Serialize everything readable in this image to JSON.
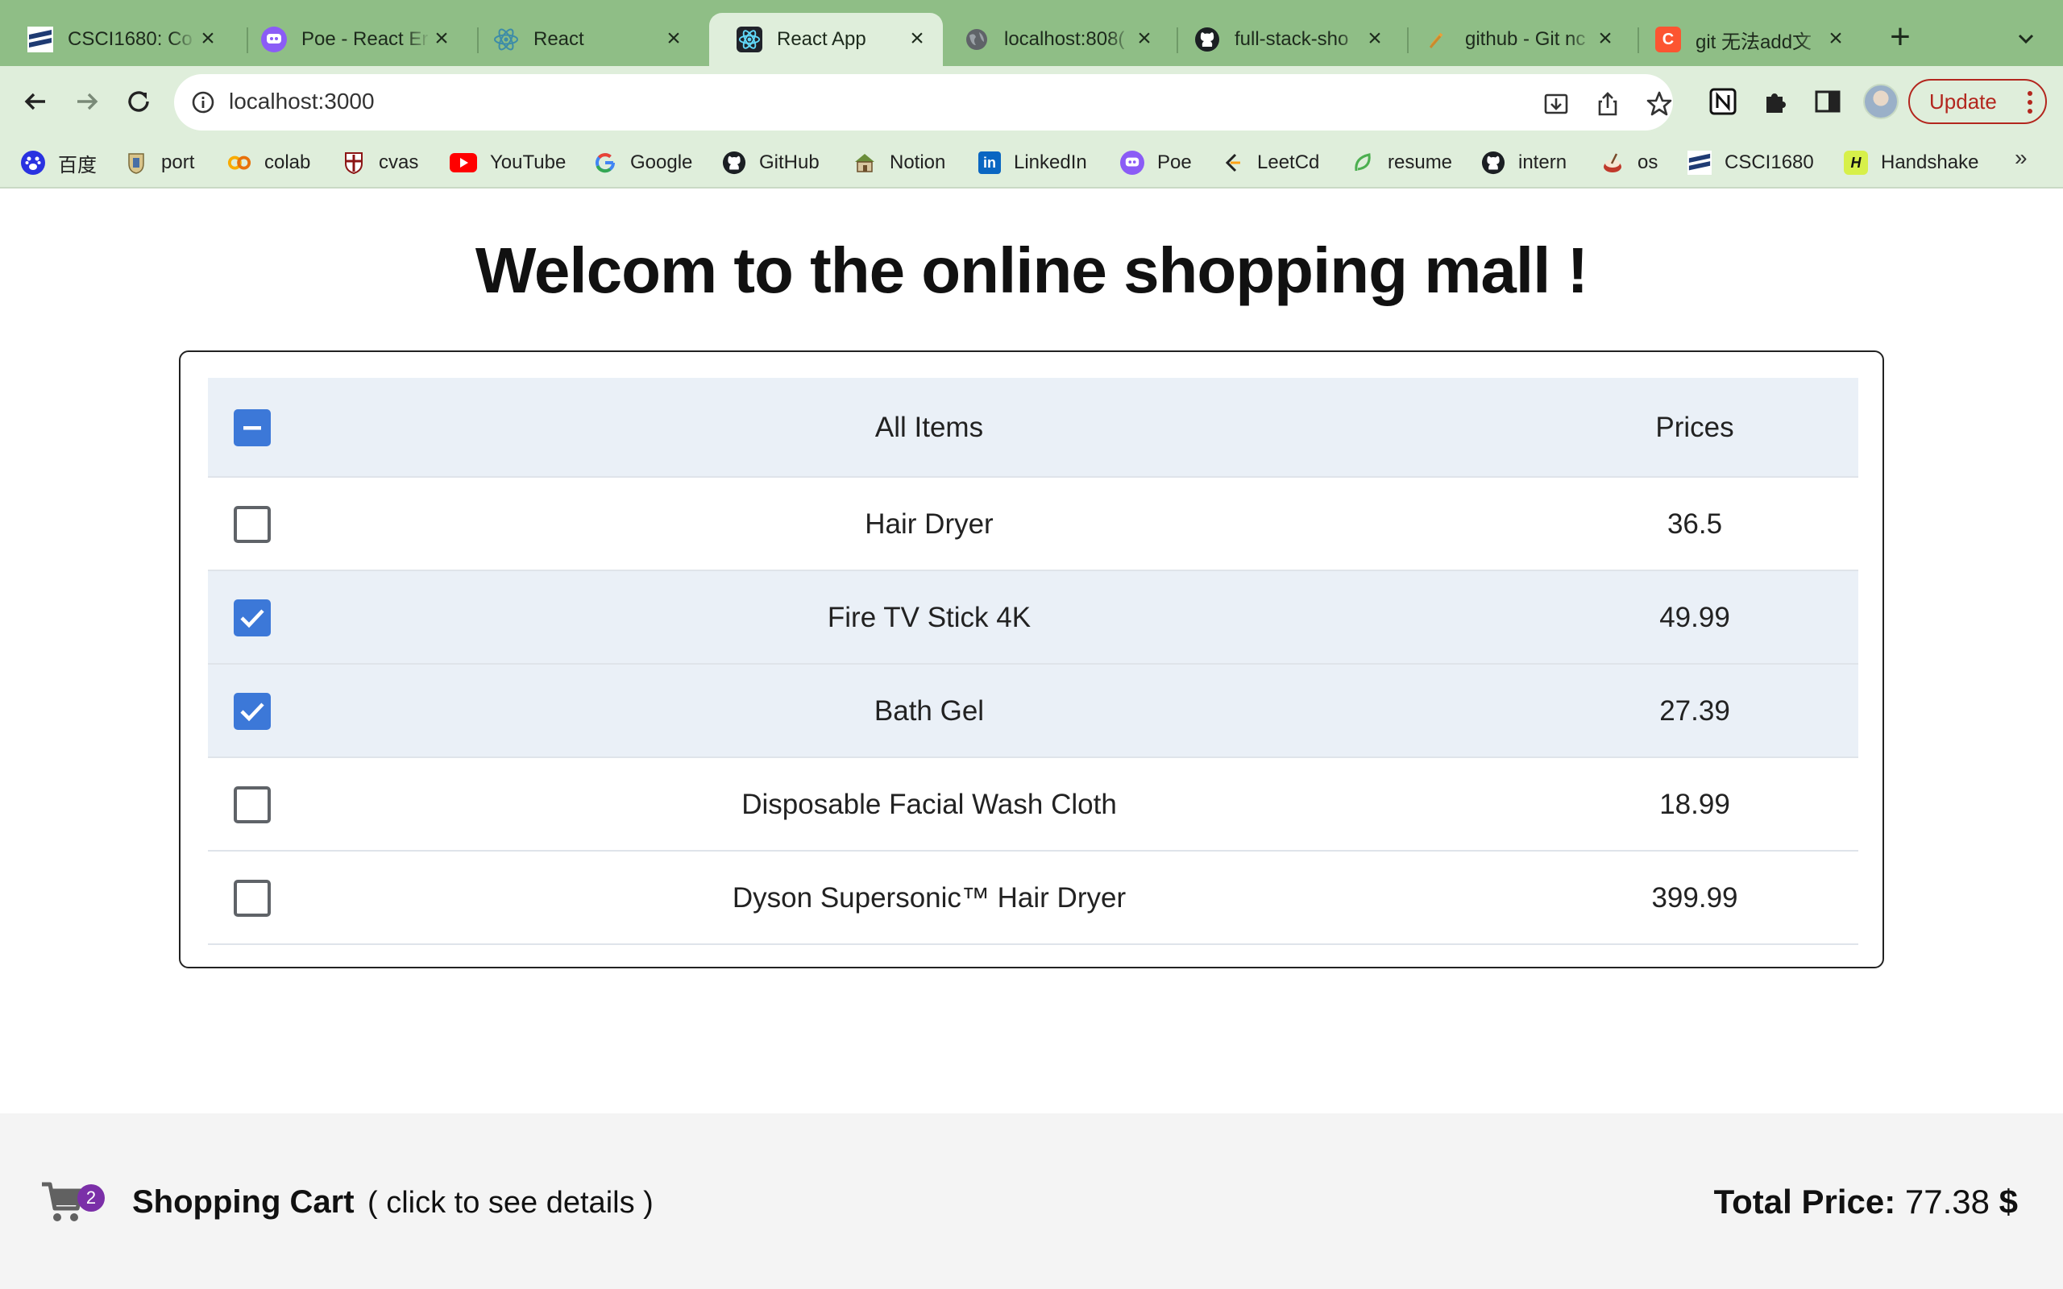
{
  "browser": {
    "tabs": [
      {
        "title": "CSCI1680: Co",
        "icon": "csci-course-icon",
        "active": false
      },
      {
        "title": "Poe - React Er",
        "icon": "poe-icon",
        "active": false
      },
      {
        "title": "React",
        "icon": "react-icon",
        "active": false
      },
      {
        "title": "React App",
        "icon": "react-icon",
        "active": true
      },
      {
        "title": "localhost:808(",
        "icon": "globe-icon",
        "active": false
      },
      {
        "title": "full-stack-sho",
        "icon": "github-icon",
        "active": false
      },
      {
        "title": "github - Git nc",
        "icon": "stackoverflow-icon",
        "active": false
      },
      {
        "title": "git 无法add文",
        "icon": "csdn-icon",
        "active": false
      }
    ],
    "address": "localhost:3000",
    "update_label": "Update",
    "bookmarks": [
      {
        "label": "百度",
        "icon": "baidu-icon"
      },
      {
        "label": "port",
        "icon": "portal-icon"
      },
      {
        "label": "colab",
        "icon": "colab-icon"
      },
      {
        "label": "cvas",
        "icon": "canvas-icon"
      },
      {
        "label": "YouTube",
        "icon": "youtube-icon"
      },
      {
        "label": "Google",
        "icon": "google-icon"
      },
      {
        "label": "GitHub",
        "icon": "github-icon"
      },
      {
        "label": "Notion",
        "icon": "notion-icon"
      },
      {
        "label": "LinkedIn",
        "icon": "linkedin-icon"
      },
      {
        "label": "Poe",
        "icon": "poe-icon"
      },
      {
        "label": "LeetCd",
        "icon": "leetcode-icon"
      },
      {
        "label": "resume",
        "icon": "leaf-icon"
      },
      {
        "label": "intern",
        "icon": "github-icon"
      },
      {
        "label": "os",
        "icon": "os-icon"
      },
      {
        "label": "CSCI1680",
        "icon": "csci-course-icon"
      },
      {
        "label": "Handshake",
        "icon": "handshake-icon"
      }
    ],
    "bookmarks_more": "»"
  },
  "page": {
    "title": "Welcom to the online shopping mall !",
    "table": {
      "header": {
        "item_label": "All Items",
        "price_label": "Prices",
        "select_all_state": "indeterminate"
      },
      "rows": [
        {
          "name": "Hair Dryer",
          "price": "36.5",
          "checked": false
        },
        {
          "name": "Fire TV Stick 4K",
          "price": "49.99",
          "checked": true
        },
        {
          "name": "Bath Gel",
          "price": "27.39",
          "checked": true
        },
        {
          "name": "Disposable Facial Wash Cloth",
          "price": "18.99",
          "checked": false
        },
        {
          "name": "Dyson Supersonic™ Hair Dryer",
          "price": "399.99",
          "checked": false
        }
      ]
    },
    "footer": {
      "cart_count": "2",
      "cart_label": "Shopping Cart",
      "cart_hint": "( click to see details )",
      "total_label": "Total Price:",
      "total_value": "77.38",
      "total_unit": "$"
    }
  },
  "colors": {
    "accent": "#3c78d8",
    "chrome": "#8fbe86",
    "toolbar": "#dfeedb",
    "update": "#b3261e",
    "badge": "#7b2fa8"
  }
}
